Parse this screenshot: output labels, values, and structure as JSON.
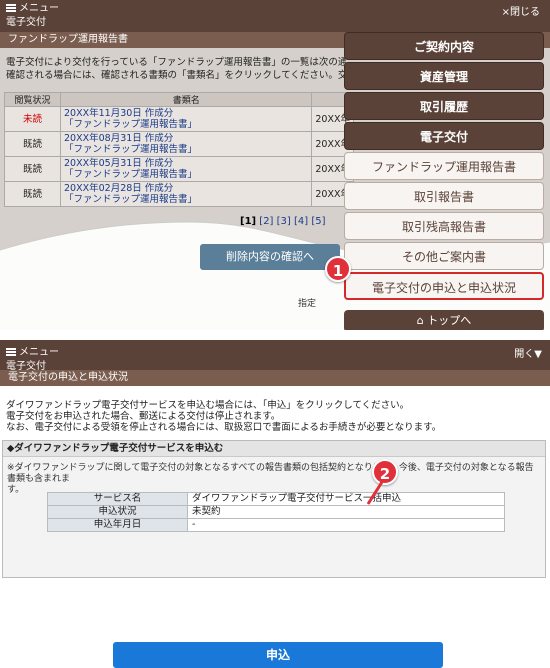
{
  "top": {
    "menu_label": "メニュー",
    "close_label": "×閉じる",
    "section_title": "電子交付",
    "breadcrumb": "ファンドラップ運用報告書",
    "intro_line1": "電子交付により交付を行っている「ファンドラップ運用報告書」の一覧は次の通りです。",
    "intro_line2": "確認される場合には、確認される書類の「書類名」をクリックしてください。交付した書類を削",
    "table": {
      "headers": [
        "閲覧状況",
        "書類名",
        ""
      ],
      "rows": [
        {
          "status": "未読",
          "date": "20XX年11月30日 作成分",
          "name": "「ファンドラップ運用報告書」",
          "issued": "20XX年"
        },
        {
          "status": "既読",
          "date": "20XX年08月31日 作成分",
          "name": "「ファンドラップ運用報告書」",
          "issued": "20XX年"
        },
        {
          "status": "既読",
          "date": "20XX年05月31日 作成分",
          "name": "「ファンドラップ運用報告書」",
          "issued": "20XX年"
        },
        {
          "status": "既読",
          "date": "20XX年02月28日 作成分",
          "name": "「ファンドラップ運用報告書」",
          "issued": "20XX年"
        }
      ]
    },
    "pager": {
      "current": "[1]",
      "pages": [
        "[2]",
        "[3]",
        "[4]",
        "[5]"
      ]
    },
    "delete_button": "削除内容の確認へ",
    "partial_text": "指定"
  },
  "menu": {
    "items": [
      {
        "label": "ご契約内容",
        "style": "dark"
      },
      {
        "label": "資産管理",
        "style": "dark"
      },
      {
        "label": "取引履歴",
        "style": "dark"
      },
      {
        "label": "電子交付",
        "style": "dark"
      },
      {
        "label": "ファンドラップ運用報告書",
        "style": "light"
      },
      {
        "label": "取引報告書",
        "style": "light"
      },
      {
        "label": "取引残高報告書",
        "style": "light"
      },
      {
        "label": "その他ご案内書",
        "style": "light"
      },
      {
        "label": "電子交付の申込と申込状況",
        "style": "highlight"
      }
    ],
    "home_label": "トップへ",
    "badge1": "1"
  },
  "bottom": {
    "menu_label": "メニュー",
    "open_label": "開く▼",
    "section_title": "電子交付",
    "breadcrumb": "電子交付の申込と申込状況",
    "text_line1": "ダイワファンドラップ電子交付サービスを申込む場合には、「申込」をクリックしてください。",
    "text_line2": "電子交付をお申込された場合、郵送による交付は停止されます。",
    "text_line3": "なお、電子交付による受領を停止される場合には、取扱窓口で書面によるお手続きが必要となります。",
    "box_title": "◆ダイワファンドラップ電子交付サービスを申込む",
    "note_line1": "※ダイワファンドラップに関して電子交付の対象となるすべての報告書類の包括契約となります。今後、電子交付の対象となる報告書類も含まれま",
    "note_line2": "す。",
    "service": {
      "rows": [
        {
          "key": "サービス名",
          "value": "ダイワファンドラップ電子交付サービス一括申込"
        },
        {
          "key": "申込状況",
          "value": "未契約"
        },
        {
          "key": "申込年月日",
          "value": "-"
        }
      ]
    },
    "apply_button": "申込",
    "badge2": "2"
  },
  "colors": {
    "brown": "#5b4238",
    "accent_red": "#e0303a",
    "apply_blue": "#1a78d8"
  }
}
